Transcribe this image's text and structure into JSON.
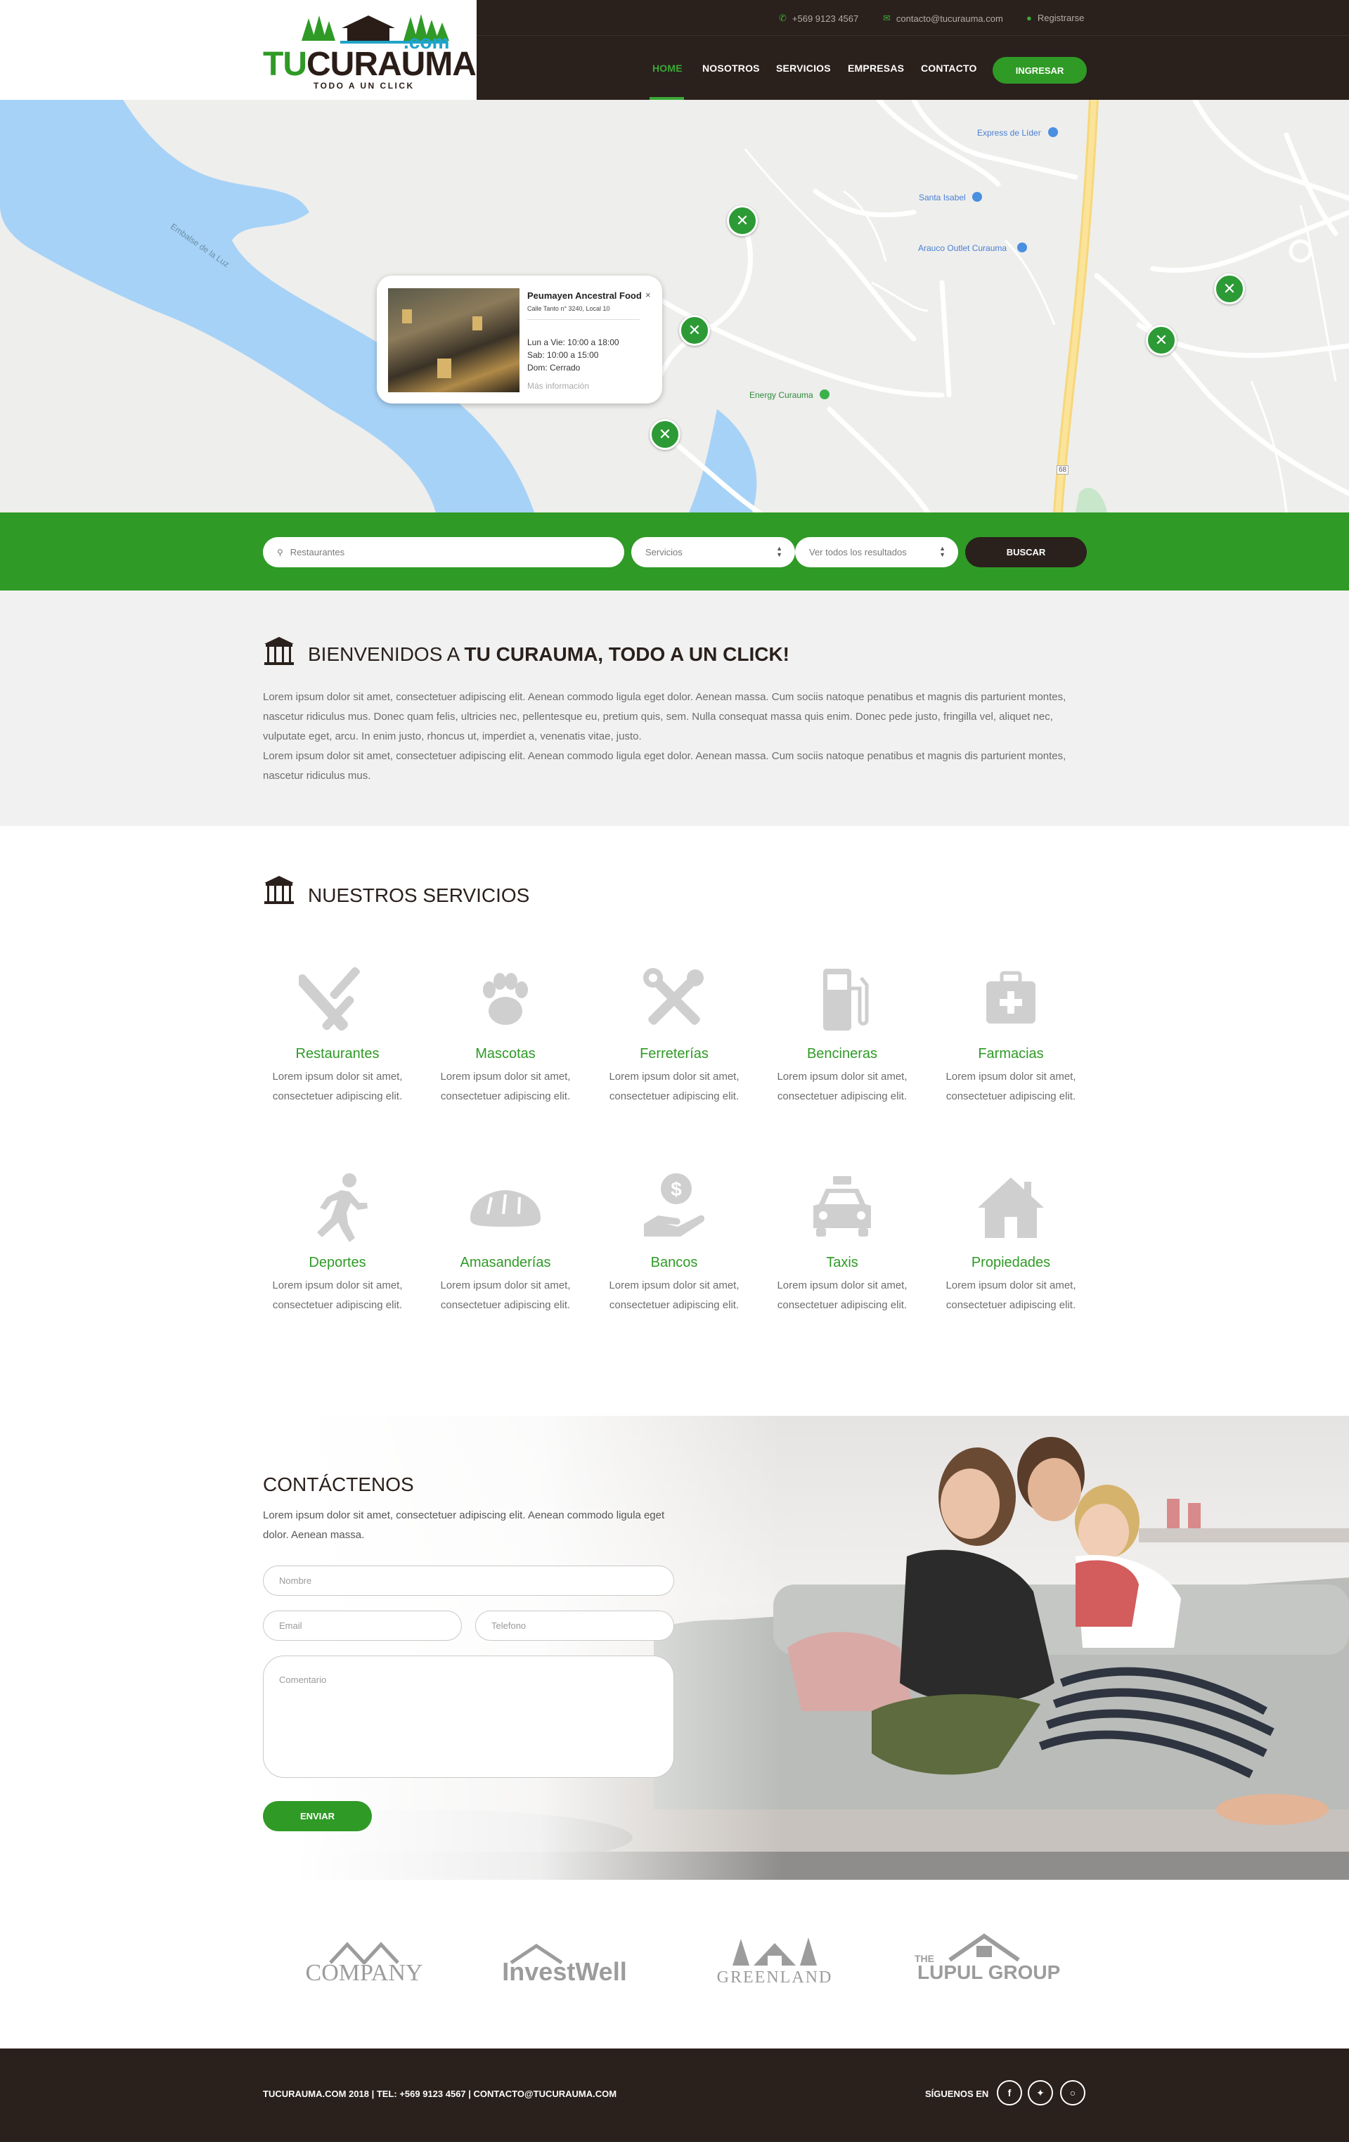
{
  "header": {
    "logo": {
      "text_tu": "TU",
      "text_curauma": "CURAUMA",
      "text_com": ".com",
      "tagline": "TODO A UN CLICK"
    },
    "topbar": {
      "phone": "+569 9123 4567",
      "email": "contacto@tucurauma.com",
      "register": "Registrarse"
    },
    "nav": [
      "HOME",
      "NOSOTROS",
      "SERVICIOS",
      "EMPRESAS",
      "CONTACTO"
    ],
    "login_button": "INGRESAR",
    "colors": {
      "accent": "#2f9a26",
      "dark": "#2a201c"
    }
  },
  "map": {
    "labels": {
      "lider": "Express de Líder",
      "santa_isabel": "Santa Isabel",
      "arauco": "Arauco Outlet Curauma",
      "energy": "Energy Curauma",
      "lake": "Embalse de la Luz",
      "route": "68"
    },
    "infowindow": {
      "title": "Peumayen Ancestral Food",
      "address": "Calle Tanto n° 3240, Local 10",
      "hours": [
        "Lun a Vie: 10:00 a 18:00",
        "Sab: 10:00 a 15:00",
        "Dom: Cerrado"
      ],
      "more": "Más información",
      "close": "×"
    }
  },
  "search": {
    "query_placeholder": "Restaurantes",
    "category": "Servicios",
    "results": "Ver todos los resultados",
    "button": "BUSCAR"
  },
  "welcome": {
    "title_prefix": "BIENVENIDOS A ",
    "title_bold": "TU CURAUMA, TODO A UN CLICK!",
    "paragraph1": "Lorem ipsum dolor sit amet, consectetuer adipiscing elit. Aenean commodo ligula eget dolor. Aenean massa. Cum sociis natoque penatibus et magnis dis parturient montes, nascetur ridiculus mus. Donec quam felis, ultricies nec, pellentesque eu, pretium quis, sem. Nulla consequat massa quis enim. Donec pede justo, fringilla vel, aliquet nec, vulputate eget, arcu. In enim justo, rhoncus ut, imperdiet a, venenatis vitae, justo.",
    "paragraph2": "Lorem ipsum dolor sit amet, consectetuer adipiscing elit. Aenean commodo ligula eget dolor. Aenean massa. Cum sociis natoque penatibus et magnis dis parturient montes, nascetur ridiculus mus."
  },
  "services": {
    "title": "NUESTROS SERVICIOS",
    "items": [
      {
        "name": "Restaurantes",
        "desc": "Lorem ipsum dolor sit amet, consectetuer adipiscing elit.",
        "icon": "utensils-icon"
      },
      {
        "name": "Mascotas",
        "desc": "Lorem ipsum dolor sit amet, consectetuer adipiscing elit.",
        "icon": "paw-icon"
      },
      {
        "name": "Ferreterías",
        "desc": "Lorem ipsum dolor sit amet, consectetuer adipiscing elit.",
        "icon": "tools-icon"
      },
      {
        "name": "Bencineras",
        "desc": "Lorem ipsum dolor sit amet, consectetuer adipiscing elit.",
        "icon": "gas-pump-icon"
      },
      {
        "name": "Farmacias",
        "desc": "Lorem ipsum dolor sit amet, consectetuer adipiscing elit.",
        "icon": "first-aid-icon"
      },
      {
        "name": "Deportes",
        "desc": "Lorem ipsum dolor sit amet, consectetuer adipiscing elit.",
        "icon": "running-icon"
      },
      {
        "name": "Amasanderías",
        "desc": "Lorem ipsum dolor sit amet, consectetuer adipiscing elit.",
        "icon": "bread-icon"
      },
      {
        "name": "Bancos",
        "desc": "Lorem ipsum dolor sit amet, consectetuer adipiscing elit.",
        "icon": "hand-dollar-icon"
      },
      {
        "name": "Taxis",
        "desc": "Lorem ipsum dolor sit amet, consectetuer adipiscing elit.",
        "icon": "taxi-icon"
      },
      {
        "name": "Propiedades",
        "desc": "Lorem ipsum dolor sit amet, consectetuer adipiscing elit.",
        "icon": "home-icon"
      }
    ]
  },
  "contact": {
    "title": "CONTÁCTENOS",
    "text": "Lorem ipsum dolor sit amet, consectetuer adipiscing elit. Aenean commodo ligula eget dolor. Aenean massa.",
    "placeholders": {
      "name": "Nombre",
      "email": "Email",
      "phone": "Telefono",
      "comment": "Comentario"
    },
    "button": "ENVIAR"
  },
  "brands": [
    {
      "name": "COMPANY"
    },
    {
      "name": "InvestWell"
    },
    {
      "name": "GREENLAND"
    },
    {
      "name": "LUPUL GROUP",
      "prefix": "THE"
    }
  ],
  "footer": {
    "text": "TUCURAUMA.COM 2018 | TEL: +569 9123 4567 | CONTACTO@TUCURAUMA.COM",
    "follow": "SÍGUENOS EN",
    "social": [
      "facebook-icon",
      "twitter-icon",
      "instagram-icon"
    ]
  }
}
